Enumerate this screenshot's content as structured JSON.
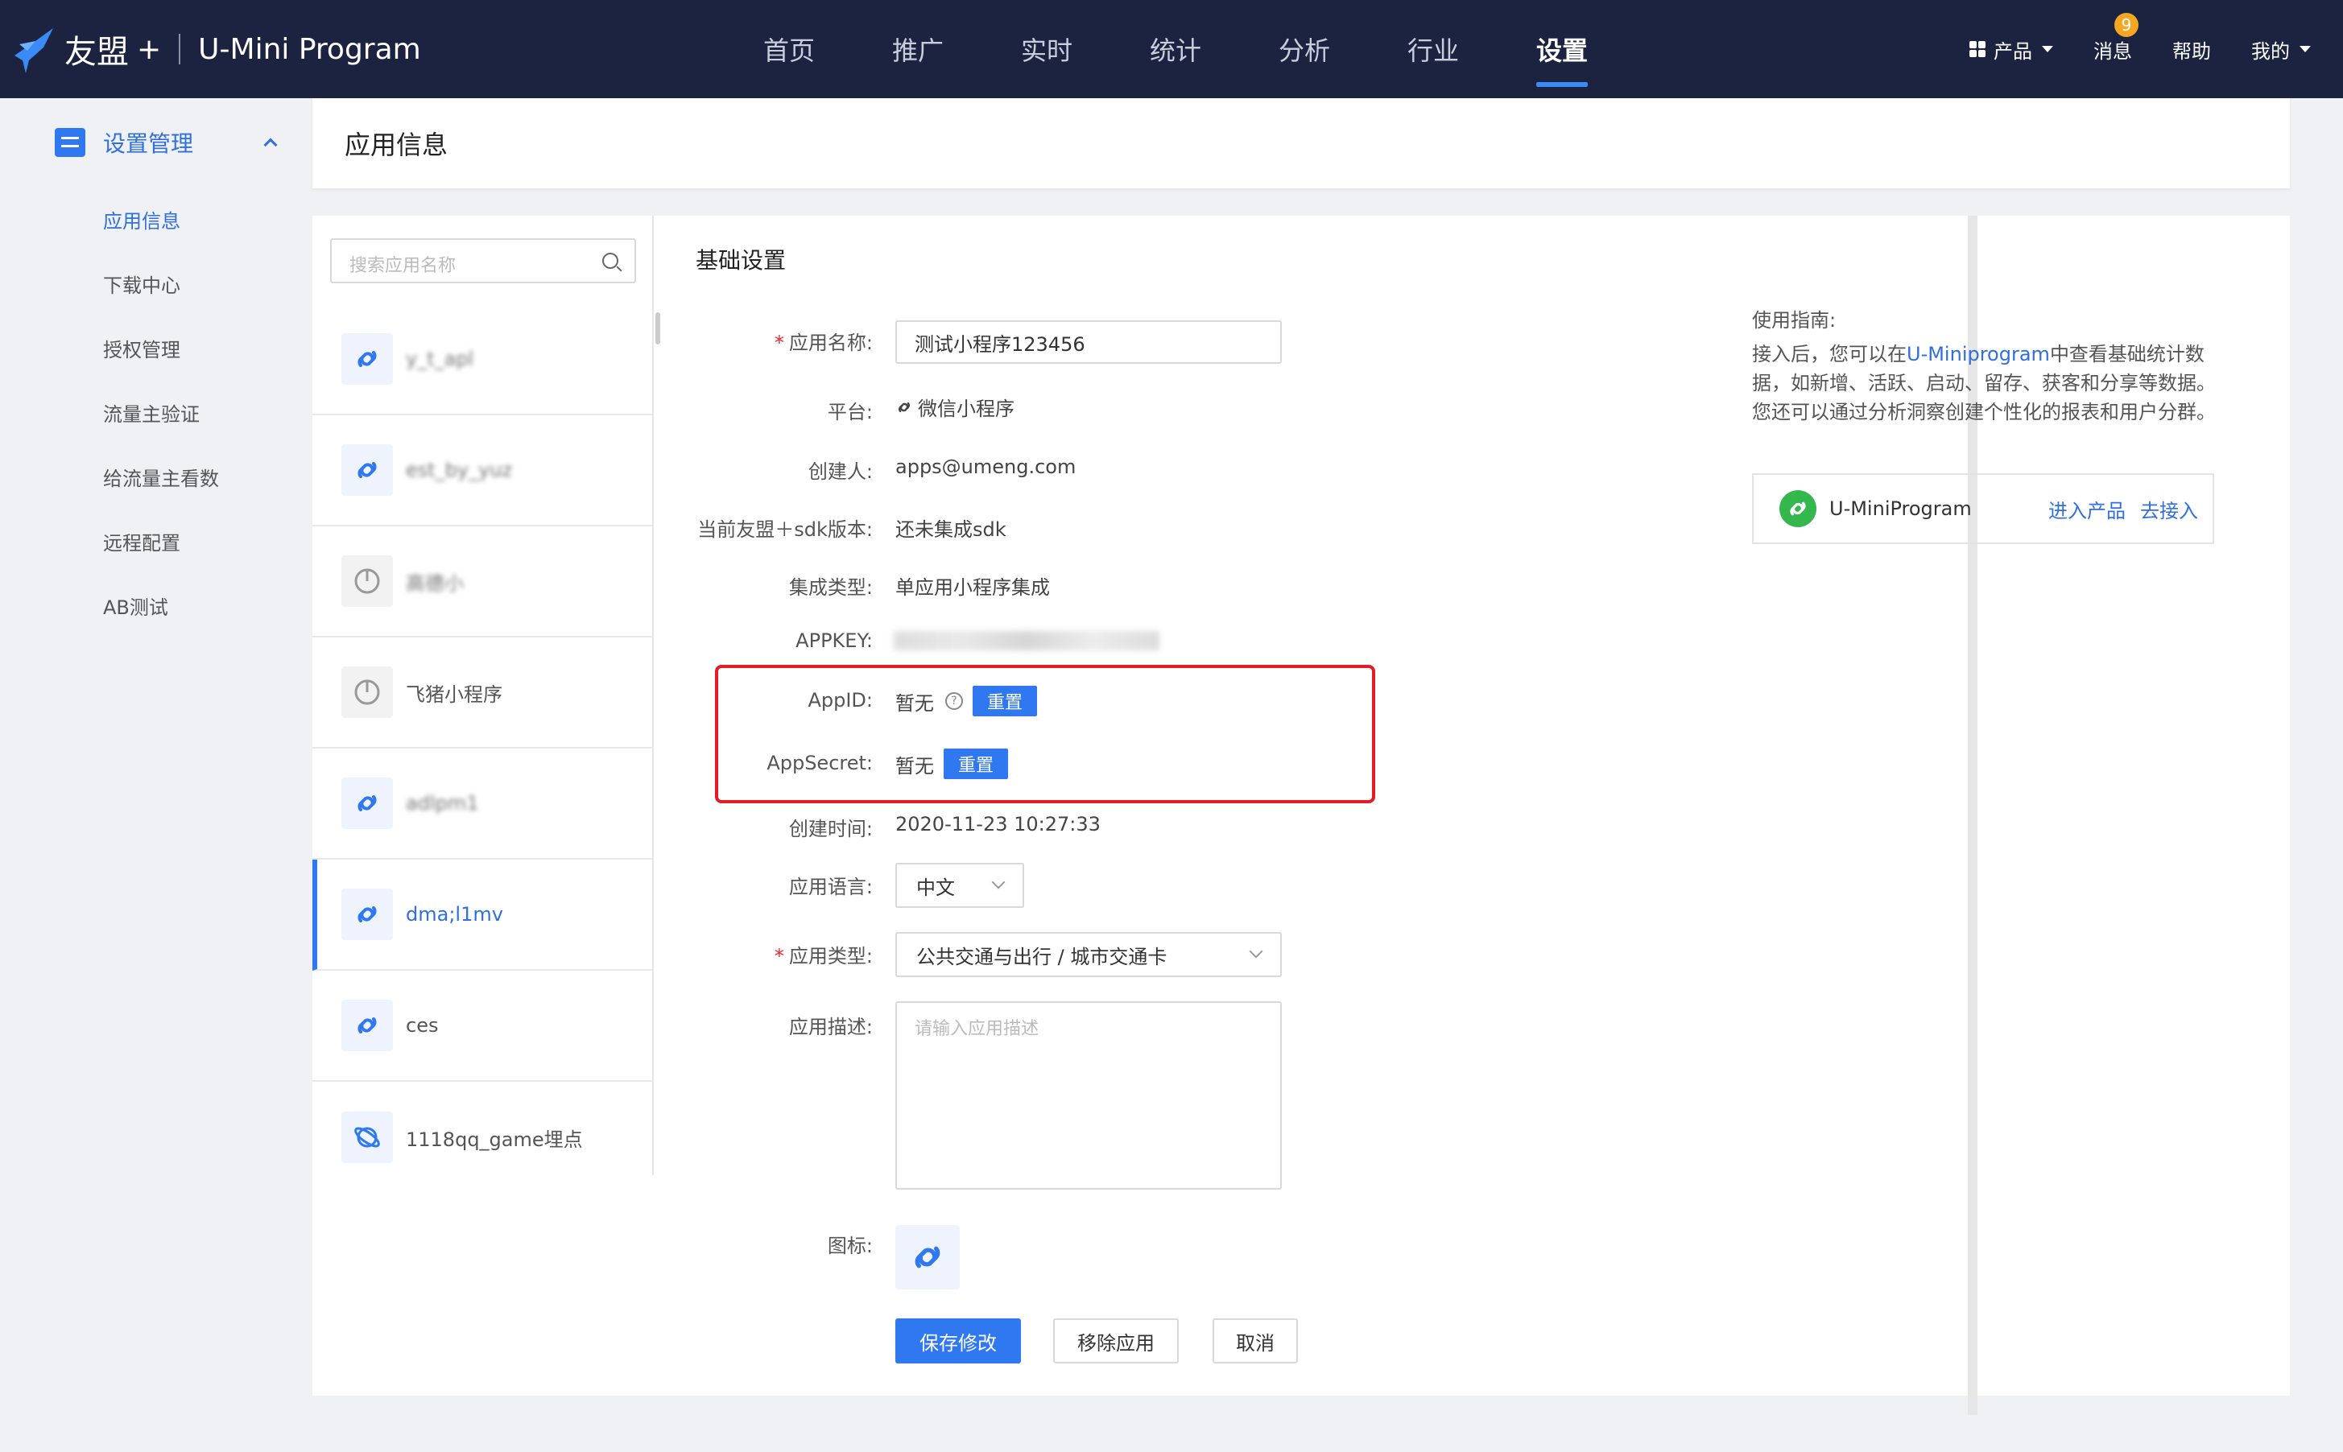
{
  "topbar": {
    "brand_name": "友盟",
    "brand_plus": "+",
    "product_name": "U-Mini Program",
    "nav": [
      {
        "label": "首页"
      },
      {
        "label": "推广"
      },
      {
        "label": "实时"
      },
      {
        "label": "统计"
      },
      {
        "label": "分析"
      },
      {
        "label": "行业"
      },
      {
        "label": "设置",
        "active": true
      }
    ],
    "products_label": "产品",
    "messages_label": "消息",
    "messages_badge": "9",
    "help_label": "帮助",
    "mine_label": "我的"
  },
  "sidenav": {
    "group_label": "设置管理",
    "items": [
      {
        "label": "应用信息",
        "active": true
      },
      {
        "label": "下载中心"
      },
      {
        "label": "授权管理"
      },
      {
        "label": "流量主验证"
      },
      {
        "label": "给流量主看数"
      },
      {
        "label": "远程配置"
      },
      {
        "label": "AB测试"
      }
    ]
  },
  "page_title": "应用信息",
  "app_list": {
    "search_placeholder": "搜索应用名称",
    "items": [
      {
        "name": "y_t_apl",
        "blurred": true,
        "icon": "link-icon"
      },
      {
        "name": "est_by_yuz",
        "blurred": true,
        "icon": "link-icon"
      },
      {
        "name": "高德小",
        "blurred": true,
        "icon": "game-icon"
      },
      {
        "name": "飞猪小程序",
        "blurred": false,
        "icon": "game-icon"
      },
      {
        "name": "adlpm1",
        "blurred": true,
        "icon": "link-icon"
      },
      {
        "name": "dma;l1mv",
        "blurred": false,
        "icon": "link-icon",
        "active": true
      },
      {
        "name": "ces",
        "blurred": false,
        "icon": "link-icon"
      },
      {
        "name": "1118qq_game埋点",
        "blurred": false,
        "icon": "planet-icon"
      }
    ]
  },
  "form": {
    "section_title": "基础设置",
    "labels": {
      "app_name": "应用名称:",
      "platform": "平台:",
      "creator": "创建人:",
      "sdk_version": "当前友盟＋sdk版本:",
      "integration_type": "集成类型:",
      "appkey": "APPKEY:",
      "appid": "AppID:",
      "appsecret": "AppSecret:",
      "created_at": "创建时间:",
      "language": "应用语言:",
      "app_type": "应用类型:",
      "description": "应用描述:",
      "icon": "图标:"
    },
    "values": {
      "app_name": "测试小程序123456",
      "platform": "微信小程序",
      "creator": "apps@umeng.com",
      "sdk_version": "还未集成sdk",
      "integration_type": "单应用小程序集成",
      "appid": "暂无",
      "appsecret": "暂无",
      "created_at": "2020-11-23 10:27:33",
      "language": "中文",
      "app_type": "公共交通与出行 / 城市交通卡",
      "description_placeholder": "请输入应用描述"
    },
    "required_mark": "*",
    "reset_label": "重置",
    "help_mark": "?",
    "save_label": "保存修改",
    "remove_label": "移除应用",
    "cancel_label": "取消"
  },
  "guide": {
    "title": "使用指南:",
    "text_before": "接入后，您可以在",
    "text_link": "U-Miniprogram",
    "text_after": "中查看基础统计数据，如新增、活跃、启动、留存、获客和分享等数据。您还可以通过分析洞察创建个性化的报表和用户分群。",
    "product_name": "U-MiniProgram",
    "enter_label": "进入产品",
    "connect_label": "去接入"
  },
  "colors": {
    "topbar": "#1b2340",
    "accent": "#2f78f0",
    "highlight_box": "#e51c23",
    "wechat_green": "#34b84e"
  }
}
